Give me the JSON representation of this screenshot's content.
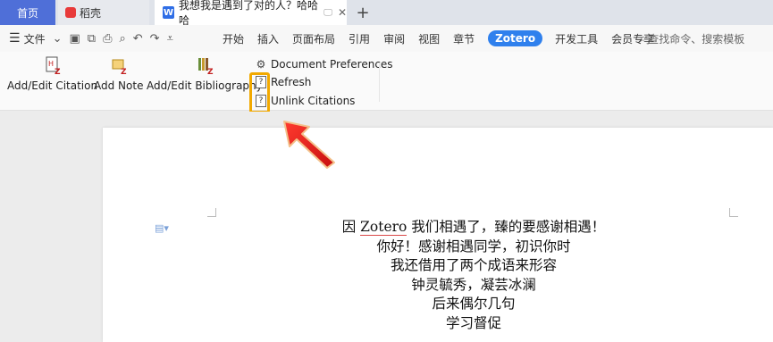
{
  "tabs": {
    "home": "首页",
    "daoke": "稻壳",
    "doc_title": "我想我是遇到了对的人？哈哈哈",
    "new_tab": "+"
  },
  "menubar": {
    "file": "文件",
    "tabs": [
      "开始",
      "插入",
      "页面布局",
      "引用",
      "审阅",
      "视图",
      "章节",
      "Zotero",
      "开发工具",
      "会员专享"
    ],
    "active_tab": "Zotero",
    "search_placeholder": "查找命令、搜索模板"
  },
  "ribbon": {
    "add_edit_citation": "Add/Edit Citation",
    "add_note": "Add Note",
    "add_edit_bibliography": "Add/Edit Bibliography",
    "document_preferences": "Document Preferences",
    "refresh": "Refresh",
    "unlink_citations": "Unlink Citations",
    "q_mark": "?"
  },
  "document": {
    "line1_prefix": "因 ",
    "line1_word": "Zotero",
    "line1_suffix": " 我们相遇了，臻的要感谢相遇！",
    "lines": [
      "你好！感谢相遇同学，初识你时",
      "我还借用了两个成语来形容",
      "钟灵毓秀，凝芸冰澜",
      "后来偶尔几句",
      "学习督促"
    ]
  },
  "colors": {
    "accent": "#2f80ed",
    "home_tab": "#4f6fd8",
    "highlight": "#f2a900",
    "arrow": "#e31d1d"
  }
}
